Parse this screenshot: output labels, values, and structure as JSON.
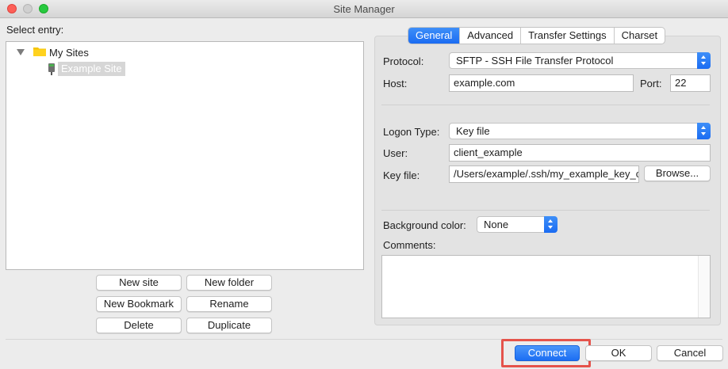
{
  "window": {
    "title": "Site Manager"
  },
  "left": {
    "select_entry_label": "Select entry:",
    "tree": {
      "root_label": "My Sites",
      "site_label": "Example Site"
    },
    "buttons": {
      "new_site": "New site",
      "new_folder": "New folder",
      "new_bookmark": "New Bookmark",
      "rename": "Rename",
      "delete": "Delete",
      "duplicate": "Duplicate"
    }
  },
  "tabs": [
    "General",
    "Advanced",
    "Transfer Settings",
    "Charset"
  ],
  "general": {
    "protocol_label": "Protocol:",
    "protocol_value": "SFTP - SSH File Transfer Protocol",
    "host_label": "Host:",
    "host_value": "example.com",
    "port_label": "Port:",
    "port_value": "22",
    "logon_type_label": "Logon Type:",
    "logon_type_value": "Key file",
    "user_label": "User:",
    "user_value": "client_example",
    "key_file_label": "Key file:",
    "key_file_value": "/Users/example/.ssh/my_example_key_c",
    "browse_label": "Browse...",
    "background_color_label": "Background color:",
    "background_color_value": "None",
    "comments_label": "Comments:"
  },
  "footer": {
    "connect": "Connect",
    "ok": "OK",
    "cancel": "Cancel"
  },
  "colors": {
    "accent": "#1b6cf2",
    "highlight": "#e5534b",
    "folder": "#f5c400"
  }
}
